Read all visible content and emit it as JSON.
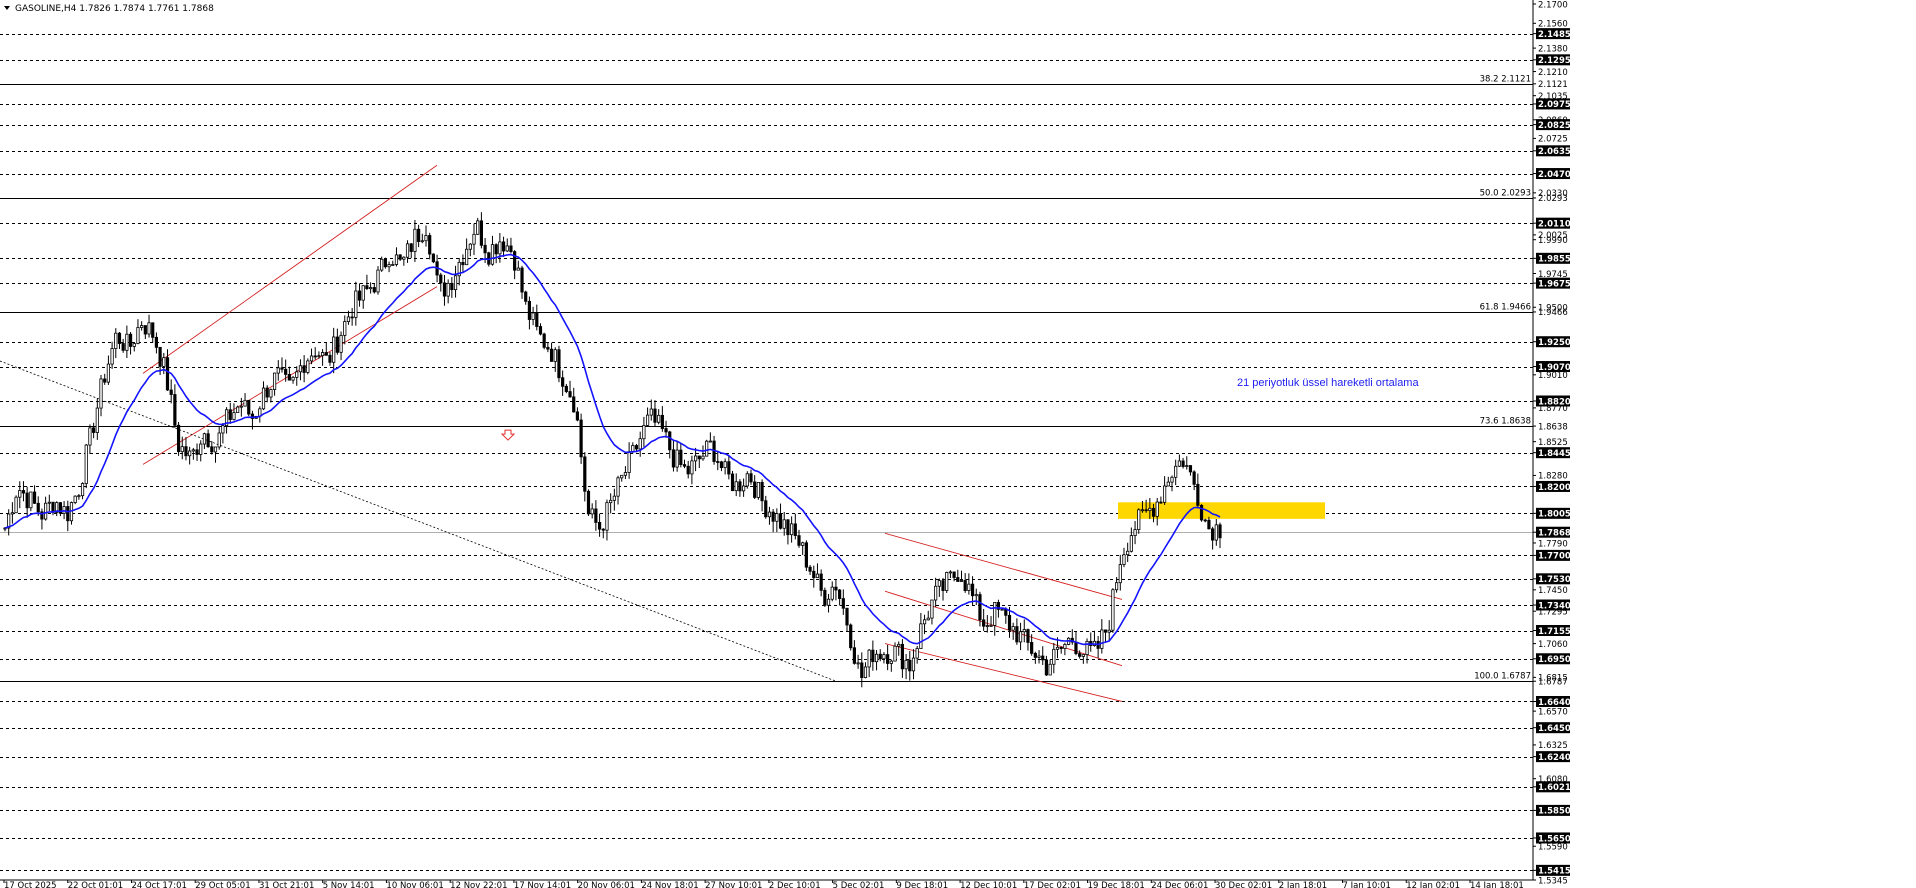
{
  "chart_header": {
    "symbol": "GASOLINE,H4",
    "ohlc": "1.7826 1.7874 1.7761 1.7868"
  },
  "chart_data": {
    "type": "candlestick",
    "title": "GASOLINE,H4 1.7826 1.7874 1.7761 1.7868",
    "ylim": [
      1.5345,
      2.17
    ],
    "y_tick_labels": [
      "2.1700",
      "2.1560",
      "2.1485",
      "2.1380",
      "2.1295",
      "2.1210",
      "2.1121",
      "2.1035",
      "2.0975",
      "2.0860",
      "2.0825",
      "2.0725",
      "2.0635",
      "2.0470",
      "2.0330",
      "2.0293",
      "2.0110",
      "2.0025",
      "1.9990",
      "1.9855",
      "1.9745",
      "1.9675",
      "1.9500",
      "1.9466",
      "1.9250",
      "1.9070",
      "1.9010",
      "1.8820",
      "1.8770",
      "1.8638",
      "1.8525",
      "1.8445",
      "1.8280",
      "1.8200",
      "1.8005",
      "1.7868",
      "1.7790",
      "1.7700",
      "1.7530",
      "1.7450",
      "1.7340",
      "1.7295",
      "1.7155",
      "1.7060",
      "1.6950",
      "1.6815",
      "1.6787",
      "1.6640",
      "1.6570",
      "1.6450",
      "1.6325",
      "1.6240",
      "1.6080",
      "1.6021",
      "1.5850",
      "1.5650",
      "1.5590",
      "1.5415",
      "1.5345"
    ],
    "boxed_levels": [
      "2.1485",
      "2.1295",
      "2.0975",
      "2.0825",
      "2.0635",
      "2.0470",
      "2.0110",
      "1.9855",
      "1.9675",
      "1.9250",
      "1.9070",
      "1.8820",
      "1.8445",
      "1.8200",
      "1.8005",
      "1.7868",
      "1.7700",
      "1.7530",
      "1.7340",
      "1.7155",
      "1.6950",
      "1.6640",
      "1.6450",
      "1.6240",
      "1.6021",
      "1.5850",
      "1.5650",
      "1.5415"
    ],
    "x_tick_labels": [
      "17 Oct 2025",
      "22 Oct 01:01",
      "24 Oct 17:01",
      "29 Oct 05:01",
      "31 Oct 21:01",
      "5 Nov 14:01",
      "10 Nov 06:01",
      "12 Nov 22:01",
      "17 Nov 14:01",
      "20 Nov 06:01",
      "24 Nov 18:01",
      "27 Nov 10:01",
      "2 Dec 10:01",
      "5 Dec 02:01",
      "9 Dec 18:01",
      "12 Dec 10:01",
      "17 Dec 02:01",
      "19 Dec 18:01",
      "24 Dec 06:01",
      "30 Dec 02:01",
      "2 Jan 18:01",
      "7 Jan 10:01",
      "12 Jan 02:01",
      "14 Jan 18:01"
    ],
    "fibonacci_levels": [
      {
        "label": "38.2 2.1121",
        "value": 2.1121
      },
      {
        "label": "50.0 2.0293",
        "value": 2.0293
      },
      {
        "label": "61.8 1.9466",
        "value": 1.9466
      },
      {
        "label": "73.6 1.8638",
        "value": 1.8638
      },
      {
        "label": "100.0 1.6787",
        "value": 1.6787
      }
    ],
    "price_path": [
      1.79,
      1.82,
      1.81,
      1.8,
      1.81,
      1.8,
      1.82,
      1.86,
      1.9,
      1.93,
      1.92,
      1.94,
      1.93,
      1.9,
      1.85,
      1.84,
      1.86,
      1.85,
      1.87,
      1.88,
      1.87,
      1.89,
      1.9,
      1.89,
      1.91,
      1.92,
      1.91,
      1.93,
      1.95,
      1.96,
      1.97,
      1.99,
      1.98,
      2.0,
      2.01,
      1.96,
      1.97,
      1.99,
      2.01,
      1.99,
      2.0,
      1.99,
      1.95,
      1.93,
      1.92,
      1.9,
      1.88,
      1.8,
      1.79,
      1.81,
      1.83,
      1.85,
      1.87,
      1.86,
      1.84,
      1.83,
      1.84,
      1.85,
      1.83,
      1.82,
      1.83,
      1.81,
      1.8,
      1.79,
      1.78,
      1.76,
      1.74,
      1.75,
      1.72,
      1.68,
      1.7,
      1.7,
      1.7,
      1.69,
      1.72,
      1.74,
      1.75,
      1.76,
      1.74,
      1.72,
      1.73,
      1.72,
      1.71,
      1.7,
      1.69,
      1.7,
      1.71,
      1.7,
      1.7,
      1.72,
      1.77,
      1.79,
      1.8,
      1.81,
      1.83,
      1.84,
      1.82,
      1.79,
      1.79
    ],
    "ema_label": "21 periyotluk üssel hareketli ortalama",
    "current_price": 1.7868,
    "arrow_marker_value": 1.858,
    "yellow_zone": [
      1.7965,
      1.8085
    ],
    "colors": {
      "ema": "#1414ff",
      "channel": "#d42020",
      "zone": "#ffd700",
      "candle": "#000000",
      "background": "#ffffff"
    }
  }
}
